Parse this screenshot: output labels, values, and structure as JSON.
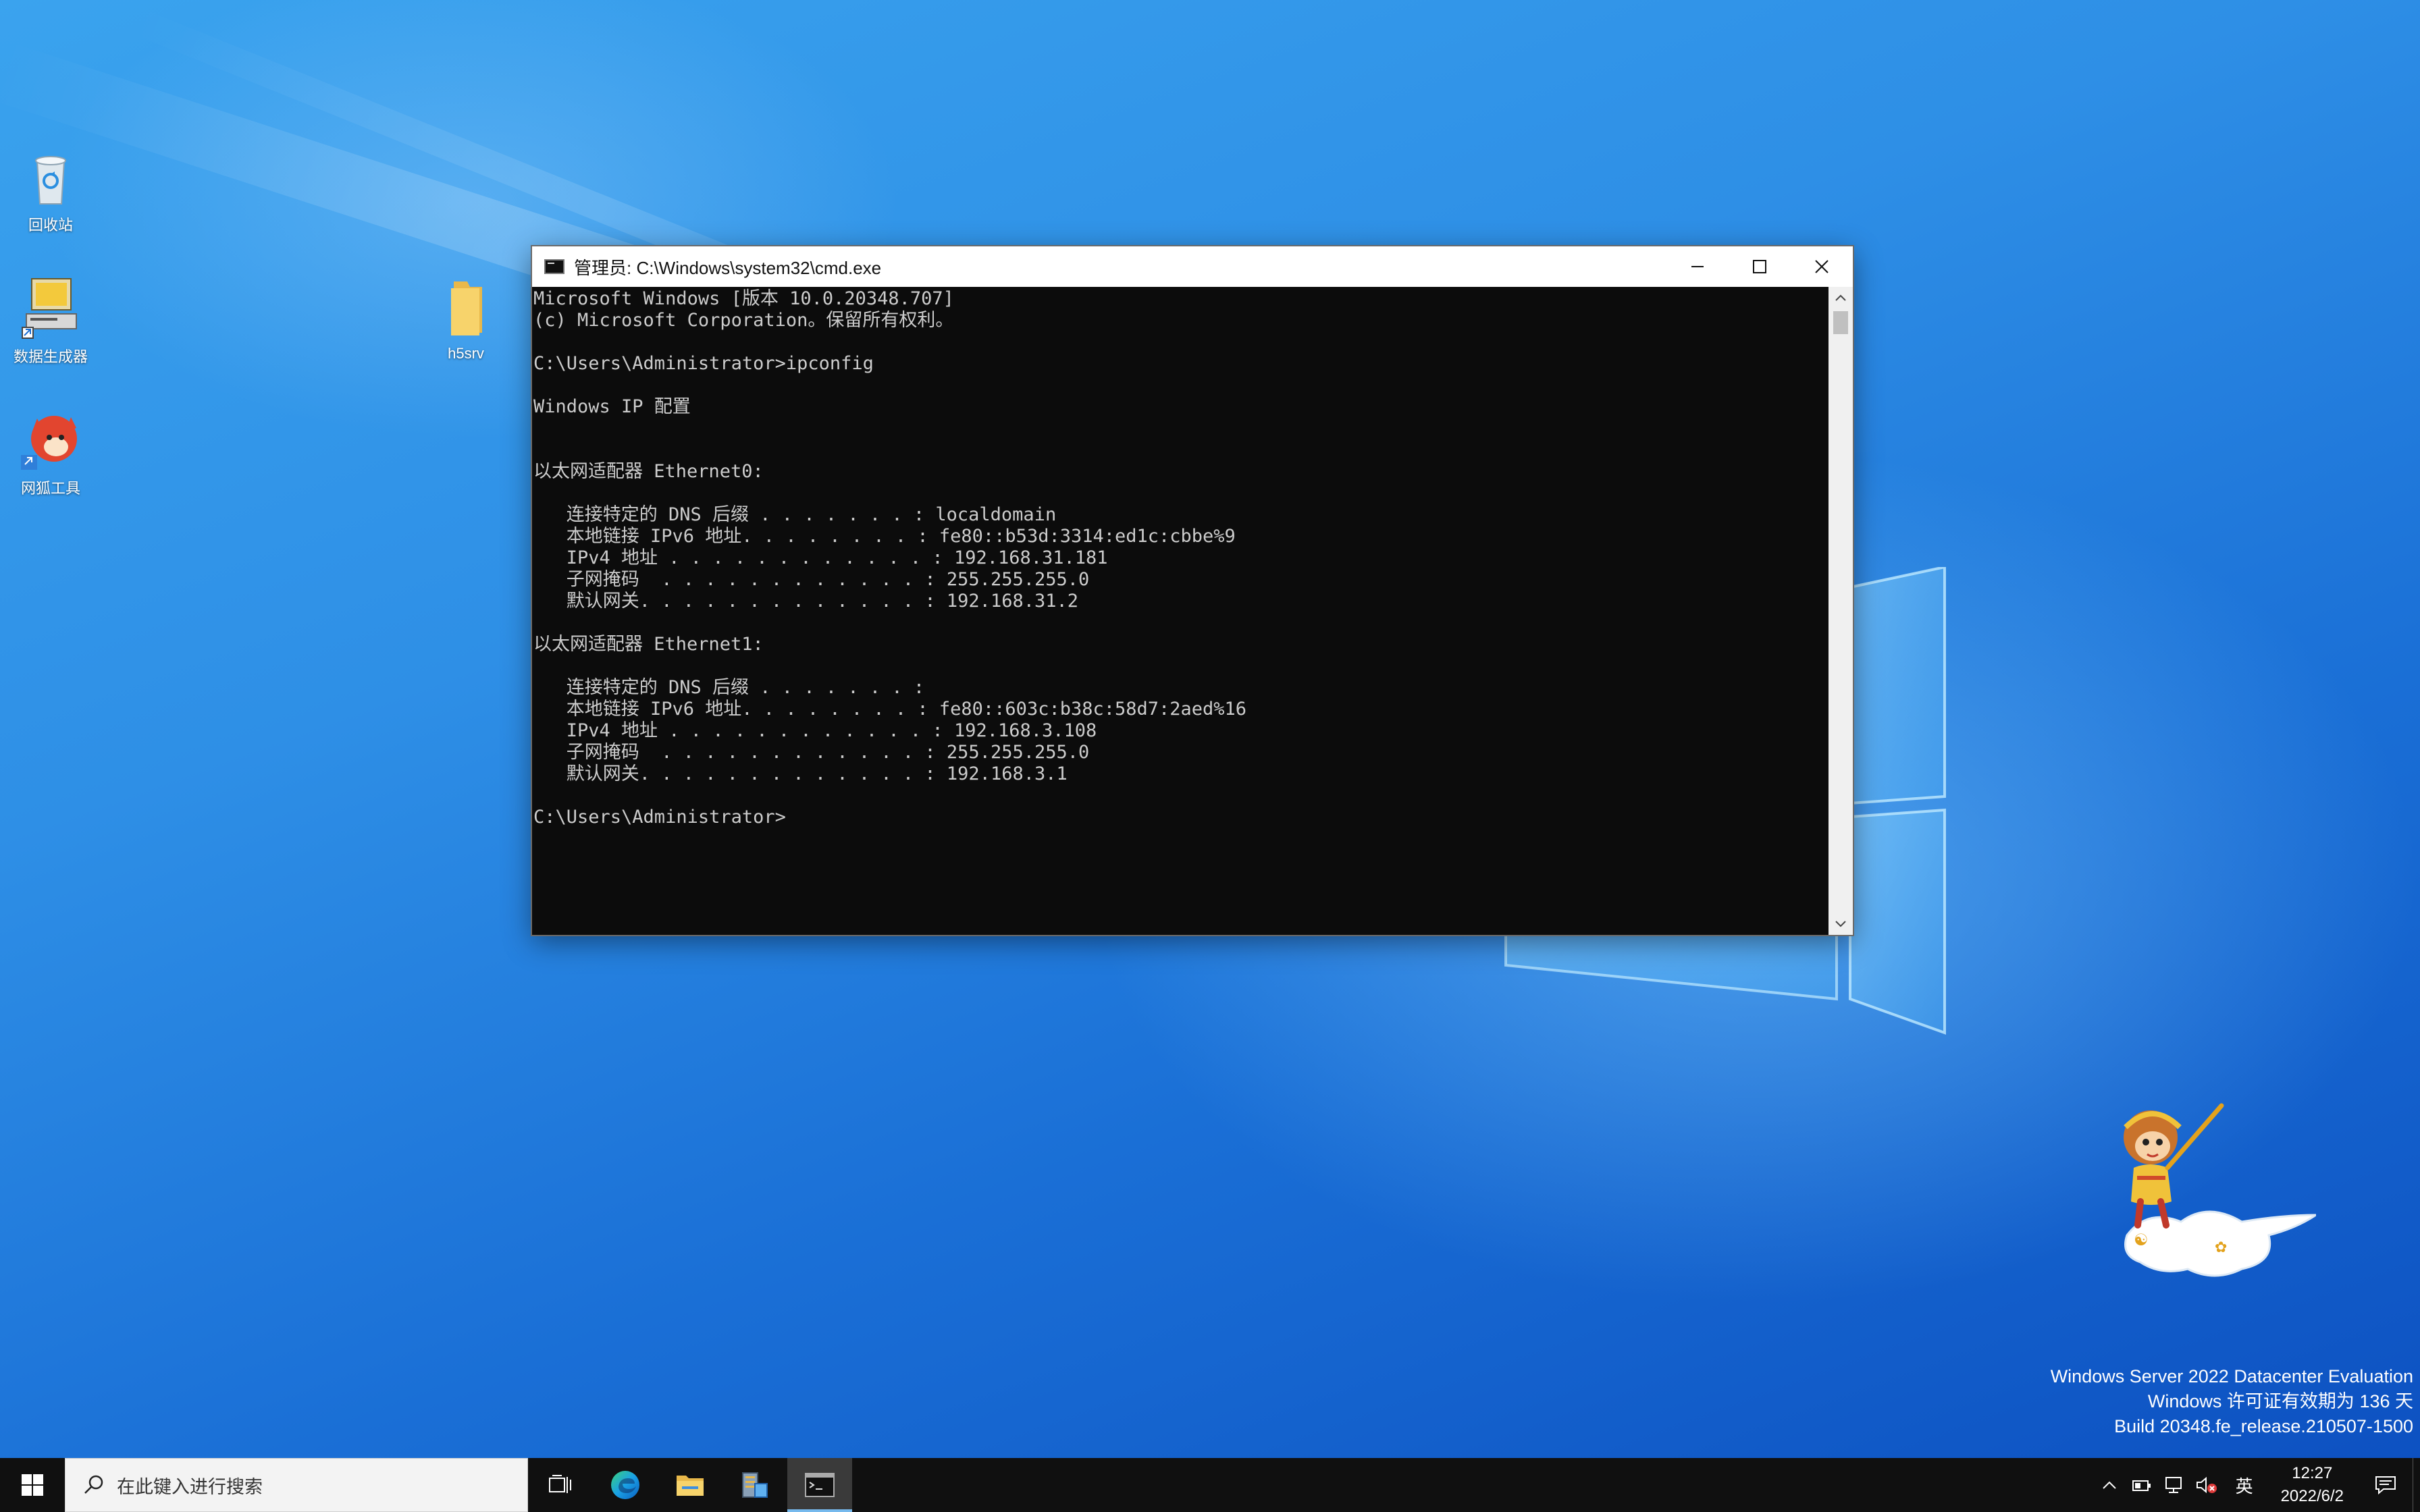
{
  "desktop": {
    "icons": [
      {
        "label": "回收站",
        "icon": "recycle-bin-icon"
      },
      {
        "label": "数据生成器",
        "icon": "data-generator-icon"
      },
      {
        "label": "网狐工具",
        "icon": "fox-tool-icon"
      },
      {
        "label": "h5srv",
        "icon": "folder-icon"
      }
    ],
    "watermark": {
      "line1": "Windows Server 2022 Datacenter Evaluation",
      "line2": "Windows 许可证有效期为 136 天",
      "line3": "Build 20348.fe_release.210507-1500"
    }
  },
  "cmd_window": {
    "title": "管理员: C:\\Windows\\system32\\cmd.exe",
    "buttons": {
      "minimize": "minimize-icon",
      "maximize": "maximize-icon",
      "close": "close-icon"
    },
    "lines": [
      "Microsoft Windows [版本 10.0.20348.707]",
      "(c) Microsoft Corporation。保留所有权利。",
      "",
      "C:\\Users\\Administrator>ipconfig",
      "",
      "Windows IP 配置",
      "",
      "",
      "以太网适配器 Ethernet0:",
      "",
      "   连接特定的 DNS 后缀 . . . . . . . : localdomain",
      "   本地链接 IPv6 地址. . . . . . . . : fe80::b53d:3314:ed1c:cbbe%9",
      "   IPv4 地址 . . . . . . . . . . . . : 192.168.31.181",
      "   子网掩码  . . . . . . . . . . . . : 255.255.255.0",
      "   默认网关. . . . . . . . . . . . . : 192.168.31.2",
      "",
      "以太网适配器 Ethernet1:",
      "",
      "   连接特定的 DNS 后缀 . . . . . . . :",
      "   本地链接 IPv6 地址. . . . . . . . : fe80::603c:b38c:58d7:2aed%16",
      "   IPv4 地址 . . . . . . . . . . . . : 192.168.3.108",
      "   子网掩码  . . . . . . . . . . . . : 255.255.255.0",
      "   默认网关. . . . . . . . . . . . . : 192.168.3.1",
      "",
      "C:\\Users\\Administrator>"
    ]
  },
  "taskbar": {
    "search_placeholder": "在此键入进行搜索",
    "apps": [
      {
        "name": "task-view",
        "icon": "task-view-icon"
      },
      {
        "name": "edge",
        "icon": "edge-icon"
      },
      {
        "name": "file-explorer",
        "icon": "file-explorer-icon"
      },
      {
        "name": "server-manager",
        "icon": "server-manager-icon"
      },
      {
        "name": "cmd",
        "icon": "cmd-icon",
        "active": true
      }
    ],
    "tray": {
      "ime": "英",
      "time": "12:27",
      "date": "2022/6/2"
    }
  },
  "colors": {
    "console_bg": "#0c0c0c",
    "console_fg": "#cccccc",
    "taskbar_bg": "#101010",
    "accent": "#76b9ed"
  }
}
